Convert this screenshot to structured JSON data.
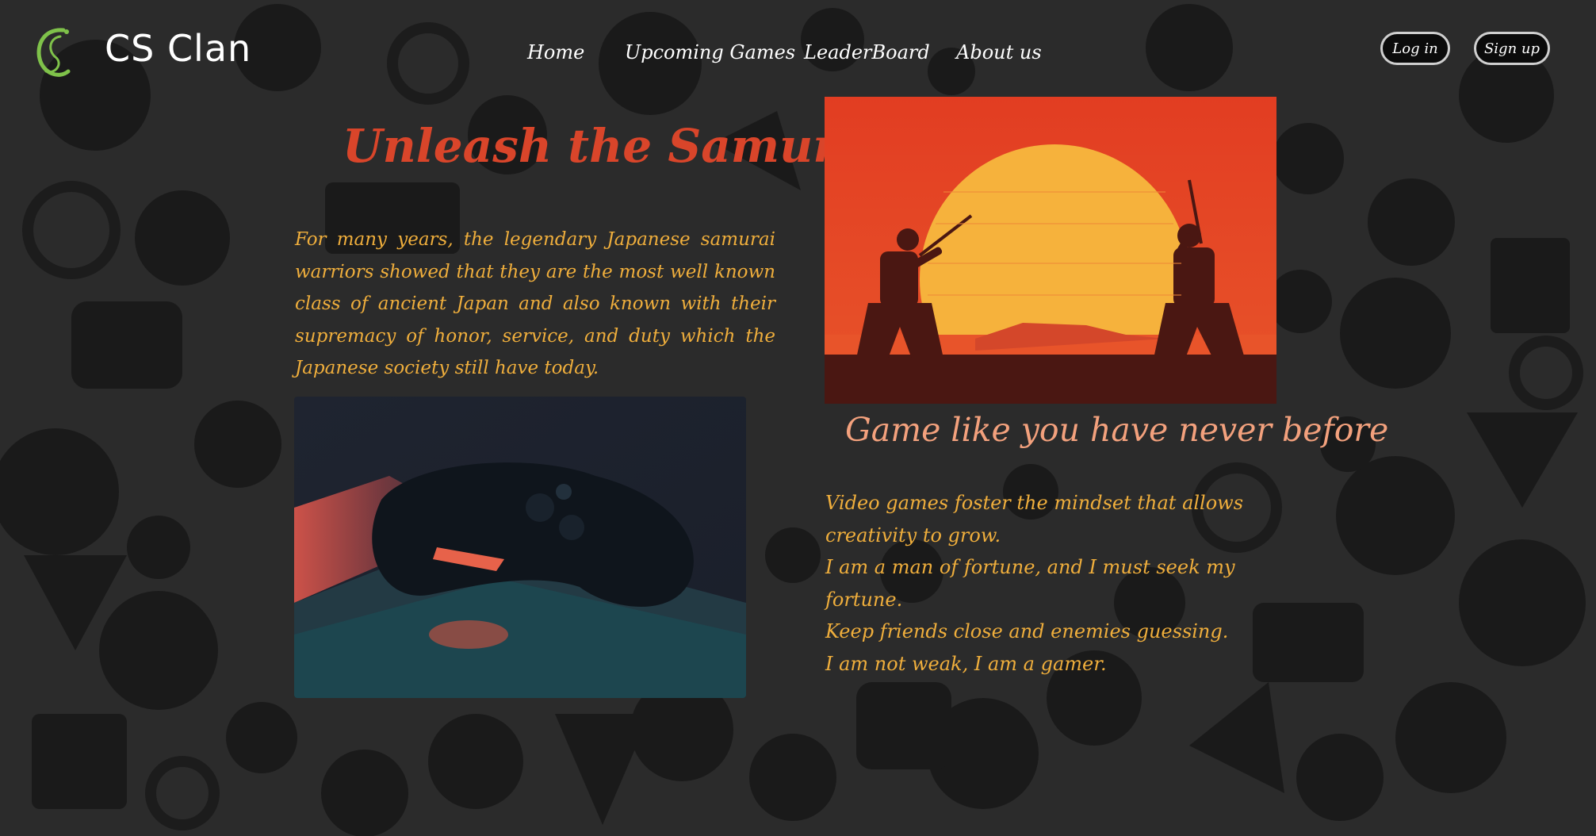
{
  "brand": {
    "name": "CS Clan",
    "logo_icon": "cs-clan-logo-icon"
  },
  "nav": {
    "items": [
      {
        "label": "Home"
      },
      {
        "label": "Upcoming Games"
      },
      {
        "label": "LeaderBoard"
      },
      {
        "label": "About us"
      }
    ]
  },
  "auth": {
    "login_label": "Log in",
    "signup_label": "Sign up"
  },
  "hero": {
    "title": "Unleash the Samurai",
    "intro": "For many years, the legendary Japanese samurai warriors showed that they are the most well known class of ancient Japan and also known with their supremacy of honor, service, and duty which the Japanese society still have today."
  },
  "feature": {
    "subtitle": "Game like you have never before",
    "quotes": [
      "Video games foster the mindset that allows creativity to grow.",
      "I am a man of fortune, and I must seek my fortune.",
      "Keep friends close and enemies guessing.",
      "I am not weak, I am a gamer."
    ]
  },
  "images": {
    "samurai": "samurai-duel-sunset-image",
    "controller": "game-controller-image"
  },
  "colors": {
    "background": "#2a2a2a",
    "title": "#d9452a",
    "body_text": "#efae3c",
    "subtitle": "#f3a17d",
    "logo_green": "#7fc24a"
  }
}
